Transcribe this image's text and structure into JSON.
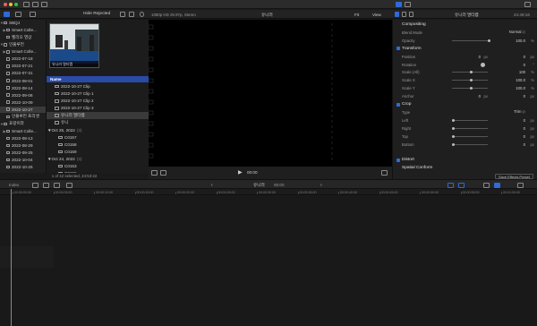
{
  "toolbar": {
    "lights": [
      "#ff5f57",
      "#febc2e",
      "#28c840"
    ]
  },
  "library_toolbar": {
    "filter": "Hide Rejected"
  },
  "sidebar": {
    "items": [
      {
        "label": "SBQJ",
        "indent": 0,
        "tri": "▼"
      },
      {
        "label": "Smart Colle...",
        "indent": 1,
        "tri": "▶"
      },
      {
        "label": "헬리오 영상",
        "indent": 1,
        "tri": ""
      },
      {
        "label": "인플루언",
        "indent": 0,
        "tri": "▼"
      },
      {
        "label": "Smart Colle...",
        "indent": 1,
        "tri": "▶"
      },
      {
        "label": "2022-07-18",
        "indent": 1,
        "tri": ""
      },
      {
        "label": "2022-07-21",
        "indent": 1,
        "tri": ""
      },
      {
        "label": "2022-07-31",
        "indent": 1,
        "tri": ""
      },
      {
        "label": "2022-08-01",
        "indent": 1,
        "tri": ""
      },
      {
        "label": "2022-08-14",
        "indent": 1,
        "tri": ""
      },
      {
        "label": "2022-09-06",
        "indent": 1,
        "tri": ""
      },
      {
        "label": "2022-10-09",
        "indent": 1,
        "tri": ""
      },
      {
        "label": "2022-10-27",
        "indent": 1,
        "tri": "",
        "selected": true
      },
      {
        "label": "인플루언 프리셋",
        "indent": 1,
        "tri": ""
      },
      {
        "label": "효랑이라",
        "indent": 0,
        "tri": "▼"
      },
      {
        "label": "Smart Colle...",
        "indent": 1,
        "tri": "▶"
      },
      {
        "label": "2022-08-13",
        "indent": 1,
        "tri": ""
      },
      {
        "label": "2022-08-29",
        "indent": 1,
        "tri": ""
      },
      {
        "label": "2022-09-25",
        "indent": 1,
        "tri": ""
      },
      {
        "label": "2022-10-04",
        "indent": 1,
        "tri": ""
      },
      {
        "label": "2022-10-25",
        "indent": 1,
        "tri": ""
      },
      {
        "label": "2022-10-26",
        "indent": 1,
        "tri": ""
      }
    ]
  },
  "browser": {
    "thumbnail_label": "유니러 멀티캠",
    "column_name": "Name",
    "rows": [
      {
        "label": "2022-10-27 Clip",
        "count": "",
        "kind": "clip",
        "indent": 2
      },
      {
        "label": "2022-10-27 Clip 1",
        "count": "",
        "kind": "clip",
        "indent": 2
      },
      {
        "label": "2022-10-27 Clip 2",
        "count": "",
        "kind": "clip",
        "indent": 2
      },
      {
        "label": "2022-10-27 Clip 3",
        "count": "",
        "kind": "clip",
        "indent": 2
      },
      {
        "label": "유니러 멀티캠",
        "count": "",
        "kind": "multicam",
        "indent": 2,
        "selected": true
      },
      {
        "label": "유니",
        "count": "",
        "kind": "multicam",
        "indent": 2
      },
      {
        "label": "▼Oct 25, 2022",
        "count": "(3)",
        "kind": "group",
        "indent": 0
      },
      {
        "label": "C0157",
        "count": "",
        "kind": "clip",
        "indent": 3
      },
      {
        "label": "C0158",
        "count": "",
        "kind": "clip",
        "indent": 3
      },
      {
        "label": "C0159",
        "count": "",
        "kind": "clip",
        "indent": 3
      },
      {
        "label": "▼Oct 24, 2022",
        "count": "(3)",
        "kind": "group",
        "indent": 0
      },
      {
        "label": "C0153",
        "count": "",
        "kind": "clip",
        "indent": 3
      },
      {
        "label": "C0155",
        "count": "",
        "kind": "clip",
        "indent": 3
      },
      {
        "label": "C0156",
        "count": "",
        "kind": "clip",
        "indent": 3
      }
    ],
    "footer": "1 of 42 selected, 24:53:22"
  },
  "viewer": {
    "format": "1080p HD 29.97p, Stereo",
    "title": "유니러",
    "fit": "Fit",
    "view": "View"
  },
  "inspector": {
    "title": "유니러 멀티캠",
    "timecode": "24:49:16",
    "rows": [
      {
        "type": "head",
        "label": "Compositing"
      },
      {
        "type": "param",
        "label": "Blend Mode",
        "value": "Normal ◇",
        "unit": ""
      },
      {
        "type": "param",
        "label": "Opacity",
        "value": "100.0",
        "unit": "%",
        "slider": 1
      },
      {
        "type": "head-check",
        "label": "Transform"
      },
      {
        "type": "xy",
        "label": "Position",
        "x": "0",
        "y": "0",
        "unit": "px"
      },
      {
        "type": "param",
        "label": "Rotation",
        "value": "0",
        "unit": "°",
        "dial": true
      },
      {
        "type": "param",
        "label": "Scale (All)",
        "value": "100",
        "unit": "%",
        "slider": 0.5
      },
      {
        "type": "param",
        "label": "Scale X",
        "value": "100.0",
        "unit": "%",
        "slider": 0.5
      },
      {
        "type": "param",
        "label": "Scale Y",
        "value": "100.0",
        "unit": "%",
        "slider": 0.5
      },
      {
        "type": "xy",
        "label": "Anchor",
        "x": "0",
        "y": "0",
        "unit": "px"
      },
      {
        "type": "head-check",
        "label": "Crop"
      },
      {
        "type": "param",
        "label": "Type",
        "value": "Trim ◇",
        "unit": ""
      },
      {
        "type": "param",
        "label": "Left",
        "value": "0",
        "unit": "px",
        "slider": 0
      },
      {
        "type": "param",
        "label": "Right",
        "value": "0",
        "unit": "px",
        "slider": 0
      },
      {
        "type": "param",
        "label": "Top",
        "value": "0",
        "unit": "px",
        "slider": 0
      },
      {
        "type": "param",
        "label": "Bottom",
        "value": "0",
        "unit": "px",
        "slider": 0
      },
      {
        "type": "blank"
      },
      {
        "type": "head-check",
        "label": "Distort"
      },
      {
        "type": "head",
        "label": "Spatial Conform"
      }
    ],
    "save_effects": "Save Effects Preset"
  },
  "timeline": {
    "index": "Index",
    "project": "유니러",
    "duration": "00:00",
    "ticks": [
      "00:00:00:00",
      "00:00:05:00",
      "00:00:10:00",
      "00:00:15:00",
      "00:00:20:00",
      "00:00:25:00",
      "00:00:30:00",
      "00:00:35:00",
      "00:00:40:00",
      "00:00:45:00",
      "00:00:50:00",
      "00:00:55:00",
      "00:01:00:00",
      "00:01:05:00"
    ]
  }
}
